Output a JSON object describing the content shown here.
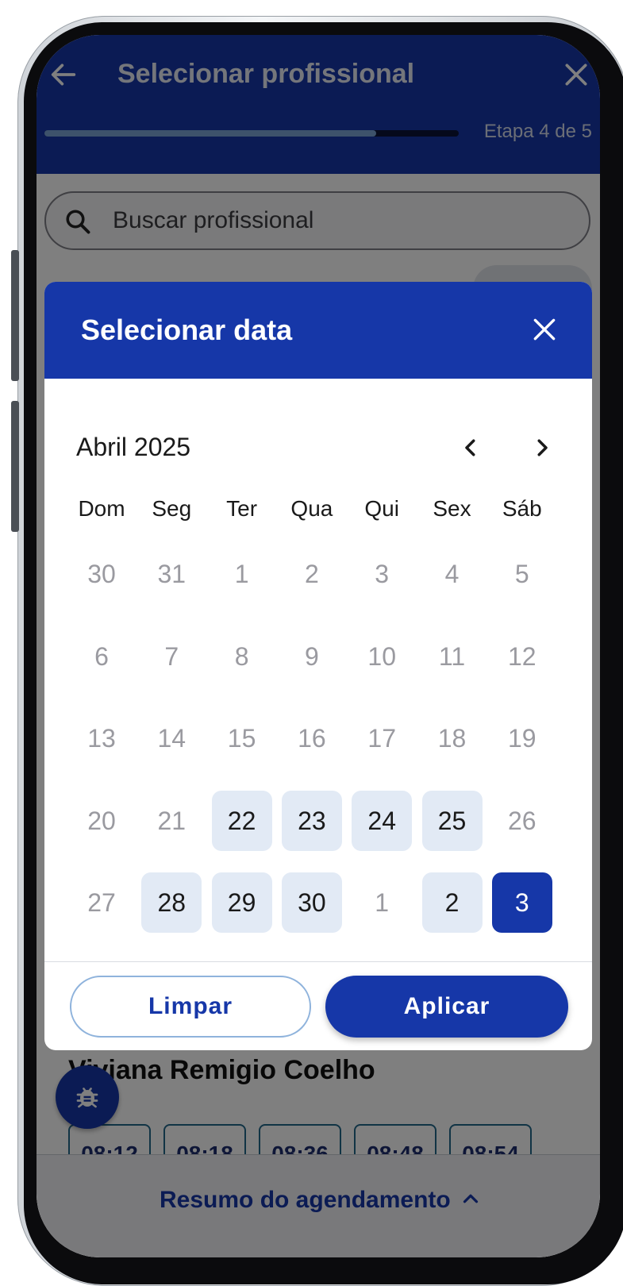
{
  "header": {
    "title": "Selecionar profissional",
    "step": "Etapa 4 de 5",
    "progress_fraction": 0.8
  },
  "search": {
    "placeholder": "Buscar profissional"
  },
  "professional": {
    "name": "Viviana Remigio Coelho",
    "times": [
      "08:12",
      "08:18",
      "08:36",
      "08:48",
      "08:54"
    ]
  },
  "footer": {
    "summary_label": "Resumo do agendamento"
  },
  "modal": {
    "title": "Selecionar data",
    "month": "Abril 2025",
    "weekdays": [
      "Dom",
      "Seg",
      "Ter",
      "Qua",
      "Qui",
      "Sex",
      "Sáb"
    ],
    "weeks": [
      [
        {
          "d": "30",
          "s": "muted"
        },
        {
          "d": "31",
          "s": "muted"
        },
        {
          "d": "1",
          "s": "muted"
        },
        {
          "d": "2",
          "s": "muted"
        },
        {
          "d": "3",
          "s": "muted"
        },
        {
          "d": "4",
          "s": "muted"
        },
        {
          "d": "5",
          "s": "muted"
        }
      ],
      [
        {
          "d": "6",
          "s": "muted"
        },
        {
          "d": "7",
          "s": "muted"
        },
        {
          "d": "8",
          "s": "muted"
        },
        {
          "d": "9",
          "s": "muted"
        },
        {
          "d": "10",
          "s": "muted"
        },
        {
          "d": "11",
          "s": "muted"
        },
        {
          "d": "12",
          "s": "muted"
        }
      ],
      [
        {
          "d": "13",
          "s": "muted"
        },
        {
          "d": "14",
          "s": "muted"
        },
        {
          "d": "15",
          "s": "muted"
        },
        {
          "d": "16",
          "s": "muted"
        },
        {
          "d": "17",
          "s": "muted"
        },
        {
          "d": "18",
          "s": "muted"
        },
        {
          "d": "19",
          "s": "muted"
        }
      ],
      [
        {
          "d": "20",
          "s": "muted"
        },
        {
          "d": "21",
          "s": "muted"
        },
        {
          "d": "22",
          "s": "avail"
        },
        {
          "d": "23",
          "s": "avail"
        },
        {
          "d": "24",
          "s": "avail"
        },
        {
          "d": "25",
          "s": "avail"
        },
        {
          "d": "26",
          "s": "muted"
        }
      ],
      [
        {
          "d": "27",
          "s": "muted"
        },
        {
          "d": "28",
          "s": "avail"
        },
        {
          "d": "29",
          "s": "avail"
        },
        {
          "d": "30",
          "s": "avail"
        },
        {
          "d": "1",
          "s": "muted"
        },
        {
          "d": "2",
          "s": "avail"
        },
        {
          "d": "3",
          "s": "sel"
        }
      ]
    ],
    "clear_label": "Limpar",
    "apply_label": "Aplicar"
  },
  "colors": {
    "primary": "#1637a8",
    "available_bg": "#e2eaf5",
    "muted_text": "#9a9aa0"
  },
  "icons": [
    "arrow-left-icon",
    "close-icon",
    "search-icon",
    "chevron-left-icon",
    "chevron-right-icon",
    "bug-icon",
    "chevron-up-icon"
  ]
}
